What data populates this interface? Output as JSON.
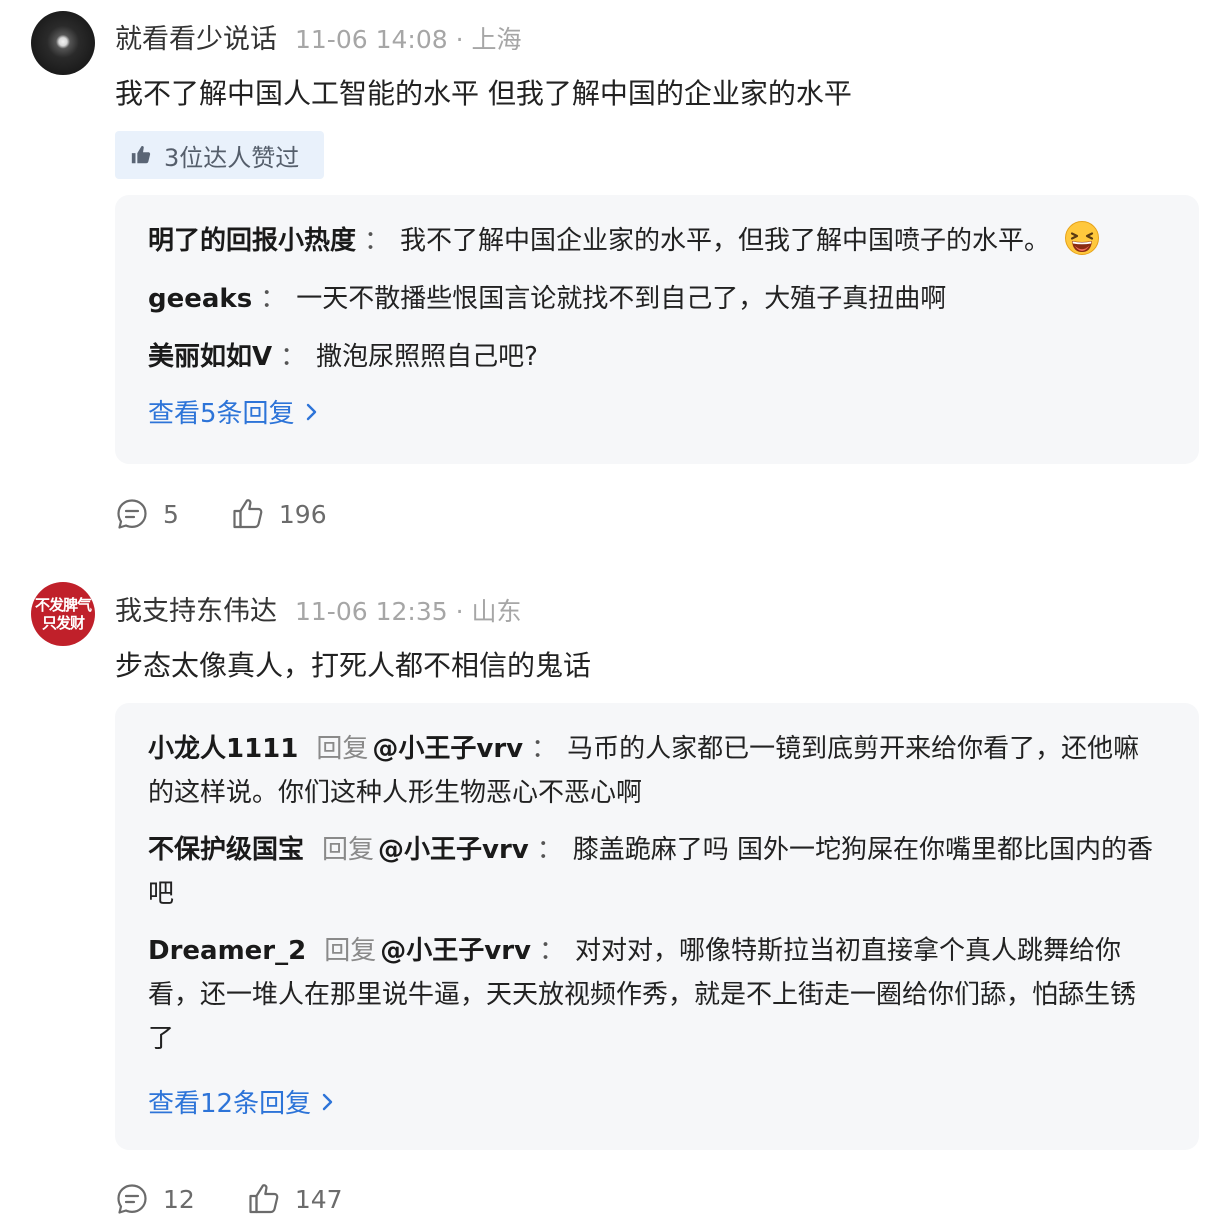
{
  "comments": [
    {
      "username": "就看看少说话",
      "time": "11-06 14:08",
      "location": "上海",
      "content": "我不了解中国人工智能的水平 但我了解中国的企业家的水平",
      "endorse_label": "3位达人赞过",
      "replies": [
        {
          "user": "明了的回报小热度",
          "text": "我不了解中国企业家的水平，但我了解中国喷子的水平。",
          "emoji": "laughing-face-emoji"
        },
        {
          "user": "geeaks",
          "text": "一天不散播些恨国言论就找不到自己了，大殖子真扭曲啊"
        },
        {
          "user": "美丽如如V",
          "text": "撒泡尿照照自己吧?"
        }
      ],
      "more_replies": "查看5条回复",
      "reply_count": "5",
      "like_count": "196"
    },
    {
      "username": "我支持东伟达",
      "time": "11-06 12:35",
      "location": "山东",
      "avatar_text": [
        "不发脾气",
        "只发财"
      ],
      "content": "步态太像真人，打死人都不相信的鬼话",
      "replies": [
        {
          "user": "小龙人1111",
          "verb": "回复",
          "target": "@小王子vrv",
          "text": "马币的人家都已一镜到底剪开来给你看了，还他嘛的这样说。你们这种人形生物恶心不恶心啊"
        },
        {
          "user": "不保护级国宝",
          "verb": "回复",
          "target": "@小王子vrv",
          "text": "膝盖跪麻了吗 国外一坨狗屎在你嘴里都比国内的香吧"
        },
        {
          "user": "Dreamer_2",
          "verb": "回复",
          "target": "@小王子vrv",
          "text": "对对对，哪像特斯拉当初直接拿个真人跳舞给你看，还一堆人在那里说牛逼，天天放视频作秀，就是不上街走一圈给你们舔，怕舔生锈了"
        }
      ],
      "more_replies": "查看12条回复",
      "reply_count": "12",
      "like_count": "147"
    }
  ],
  "separator": "·",
  "reply_separator": "：",
  "colors": {
    "link": "#2d74d8",
    "meta": "#a6a6a6",
    "reply_bg": "#f6f7f9",
    "endorse_bg": "#e9f1fb"
  }
}
